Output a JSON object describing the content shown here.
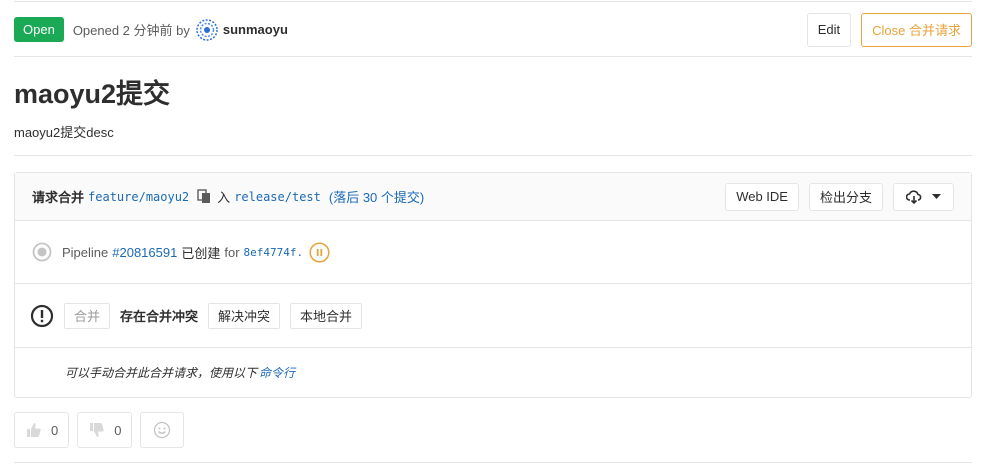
{
  "header": {
    "status": "Open",
    "opened_text": "Opened 2 分钟前 by",
    "author": "sunmaoyu",
    "edit_label": "Edit",
    "close_label": "Close 合并请求"
  },
  "title": "maoyu2提交",
  "description": "maoyu2提交desc",
  "widget": {
    "request_label": "请求合并",
    "source_branch": "feature/maoyu2",
    "into_label": "入",
    "target_branch": "release/test",
    "behind_text": "(落后 30 个提交)",
    "web_ide_label": "Web IDE",
    "checkout_label": "检出分支",
    "pipeline": {
      "label": "Pipeline",
      "link": "#20816591",
      "created": "已创建",
      "for": "for",
      "commit": "8ef4774f."
    },
    "conflict": {
      "merge_label": "合并",
      "text": "存在合并冲突",
      "resolve_label": "解决冲突",
      "local_label": "本地合并"
    },
    "footer": {
      "text": "可以手动合并此合并请求，使用以下",
      "link": "命令行"
    }
  },
  "awards": {
    "thumbsup_count": "0",
    "thumbsdown_count": "0"
  },
  "colors": {
    "open_badge": "#1aaa55",
    "close_button": "#e7a33c",
    "link": "#1b69b6"
  }
}
